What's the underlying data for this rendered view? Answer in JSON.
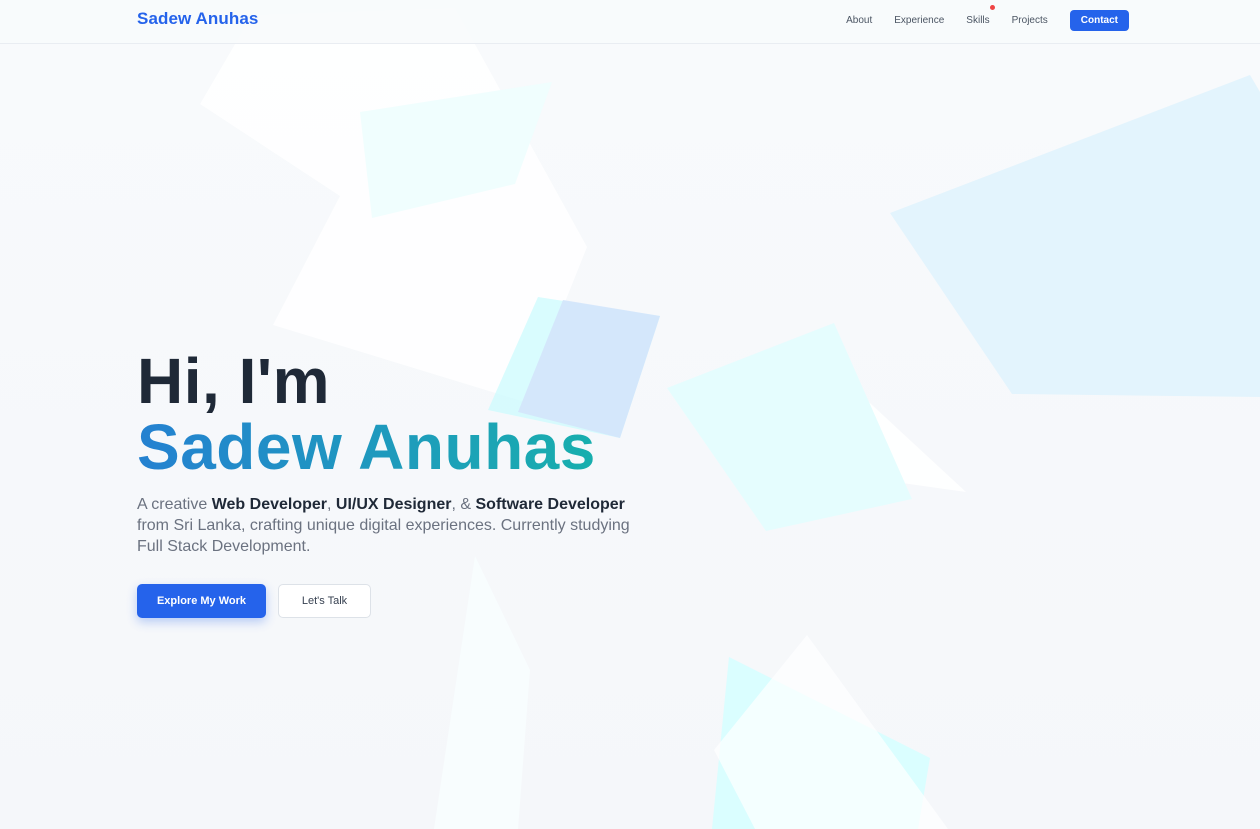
{
  "nav": {
    "brand": "Sadew Anuhas",
    "links": [
      "About",
      "Experience",
      "Skills",
      "Projects"
    ],
    "contact_label": "Contact"
  },
  "hero": {
    "greeting": "Hi, I'm",
    "name": "Sadew Anuhas",
    "description": {
      "prefix": "A creative ",
      "role1": "Web Developer",
      "sep1": ", ",
      "role2": "UI/UX Designer",
      "sep2": ", & ",
      "role3": "Software Developer",
      "suffix": " from Sri Lanka, crafting unique digital experiences. Currently studying Full Stack Development."
    },
    "primary_button": "Explore My Work",
    "secondary_button": "Let's Talk"
  },
  "colors": {
    "accent": "#2563eb",
    "gradient_start": "#2481d1",
    "gradient_end": "#14b8a6",
    "notification_dot": "#ef4444"
  }
}
